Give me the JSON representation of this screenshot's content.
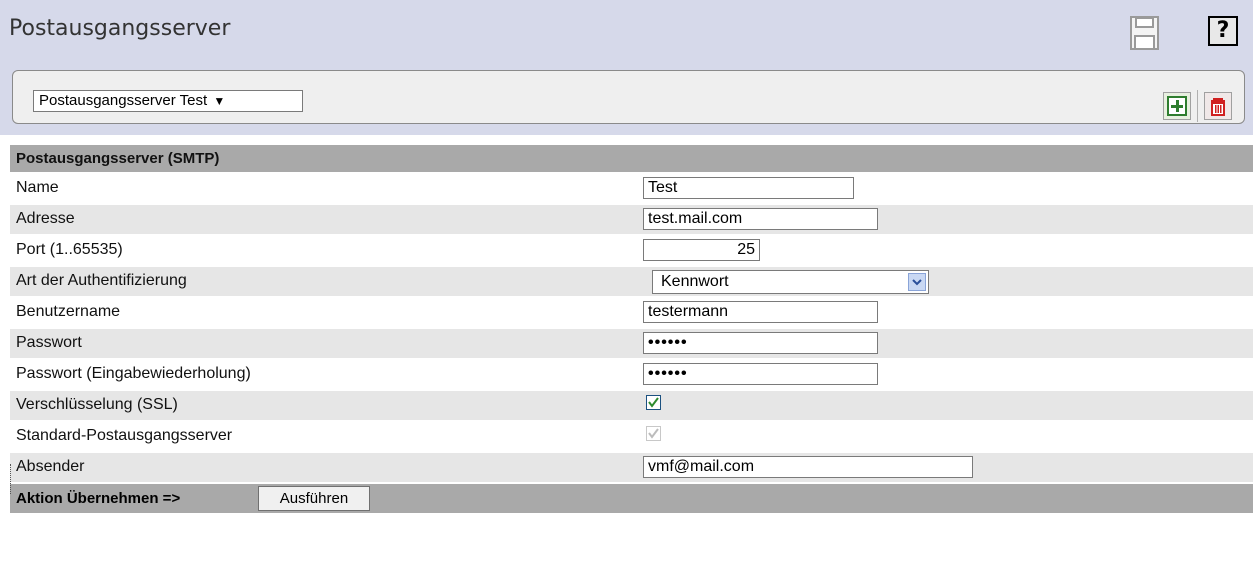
{
  "header": {
    "title": "Postausgangsserver",
    "save_icon": "floppy-disk-icon",
    "help_label": "?"
  },
  "selector": {
    "selected_server": "Postausgangsserver Test",
    "arrow": "▼",
    "add_icon": "plus-icon",
    "delete_icon": "trash-icon"
  },
  "form": {
    "section_title": "Postausgangsserver (SMTP)",
    "rows": [
      {
        "label": "Name",
        "type": "text",
        "value": "Test"
      },
      {
        "label": "Adresse",
        "type": "text",
        "value": "test.mail.com"
      },
      {
        "label": "Port (1..65535)",
        "type": "text",
        "value": "25"
      },
      {
        "label": "Art der Authentifizierung",
        "type": "select",
        "value": "Kennwort"
      },
      {
        "label": "Benutzername",
        "type": "text",
        "value": "testermann"
      },
      {
        "label": "Passwort",
        "type": "password",
        "value": "••••••"
      },
      {
        "label": "Passwort (Eingabewiederholung)",
        "type": "password",
        "value": "••••••"
      },
      {
        "label": "Verschlüsselung (SSL)",
        "type": "checkbox",
        "checked": true
      },
      {
        "label": "Standard-Postausgangsserver",
        "type": "checkbox",
        "checked": true,
        "disabled": true
      },
      {
        "label": "Absender",
        "type": "text",
        "value": "vmf@mail.com"
      }
    ]
  },
  "action": {
    "label": "Aktion Übernehmen =>",
    "button": "Ausführen"
  },
  "colors": {
    "header_bg": "#d6d9ea",
    "section_bg": "#a9a9a9",
    "row_alt_bg": "#e6e6e6",
    "checkmark": "#2e8b2e"
  }
}
